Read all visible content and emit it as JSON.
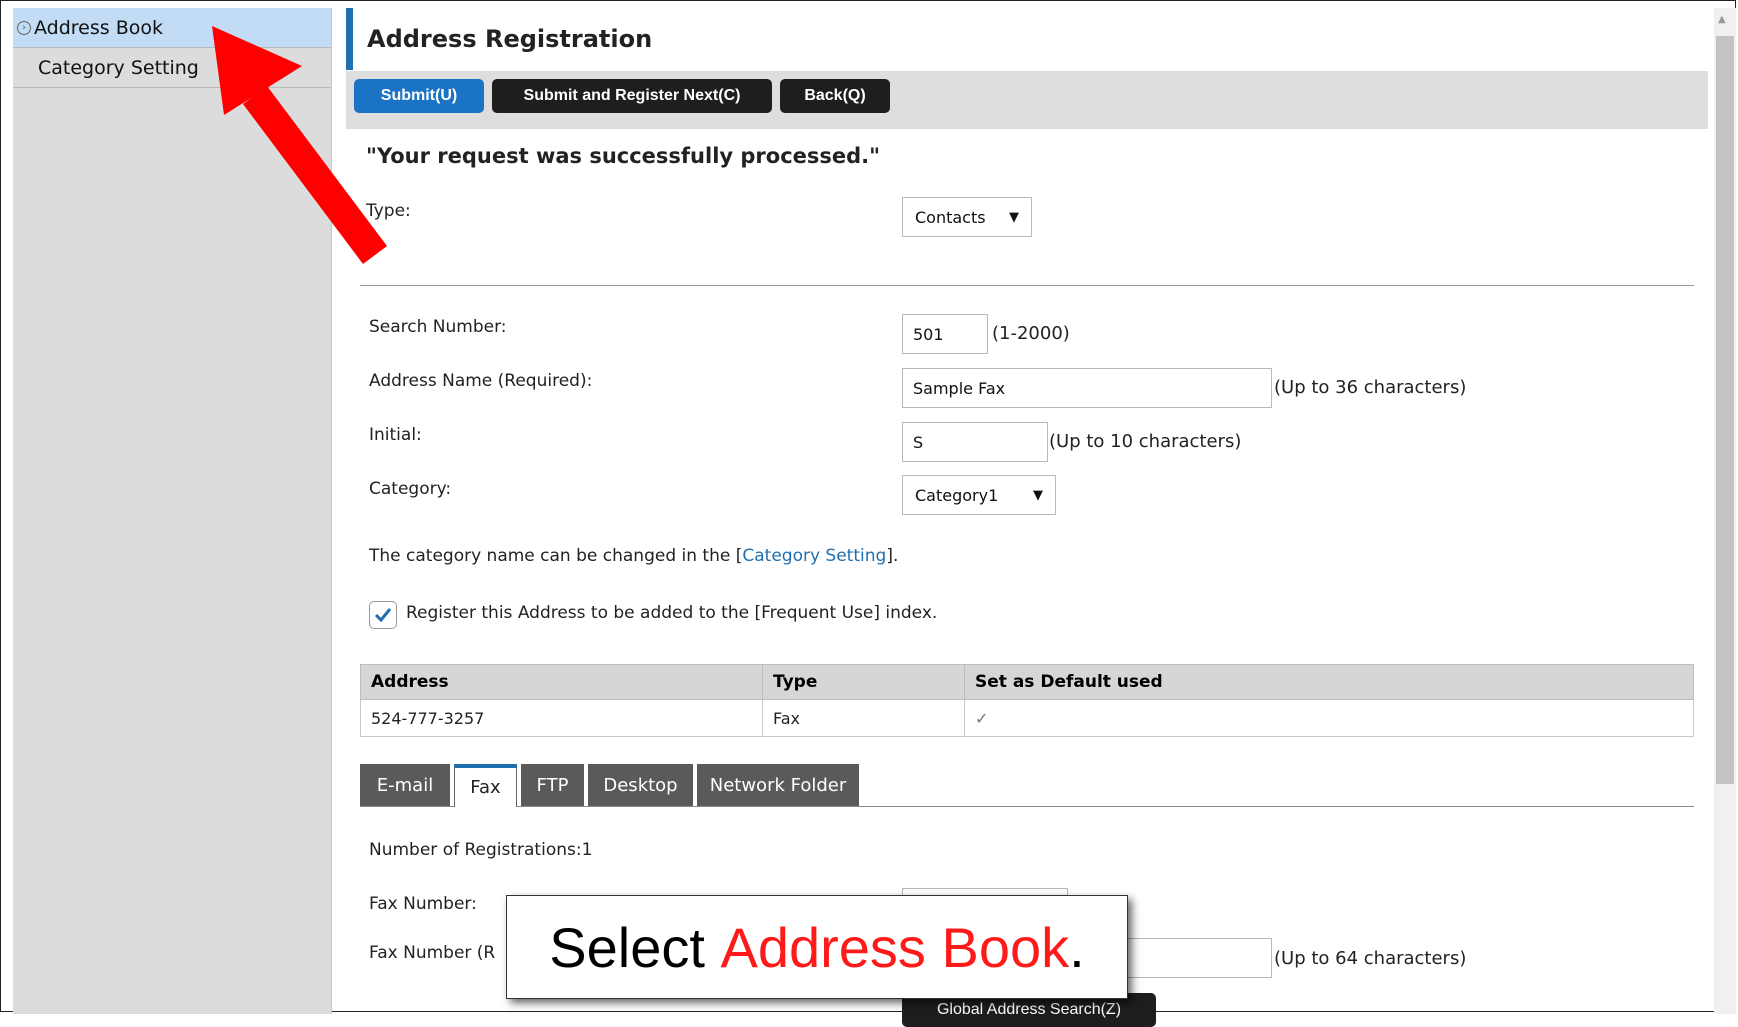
{
  "sidebar": {
    "items": [
      {
        "label": "Address Book",
        "active": true
      },
      {
        "label": "Category Setting",
        "active": false
      }
    ]
  },
  "header": {
    "title": "Address Registration"
  },
  "toolbar": {
    "submit": "Submit(U)",
    "submit_next": "Submit and Register Next(C)",
    "back": "Back(Q)"
  },
  "message": "\"Your request was successfully processed.\"",
  "form": {
    "type_label": "Type:",
    "type_value": "Contacts",
    "search_number_label": "Search Number:",
    "search_number_value": "501",
    "search_number_hint": "(1-2000)",
    "address_name_label": "Address Name (Required):",
    "address_name_value": "Sample Fax",
    "address_name_hint": "(Up to 36 characters)",
    "initial_label": "Initial:",
    "initial_value": "S",
    "initial_hint": "(Up to 10 characters)",
    "category_label": "Category:",
    "category_value": "Category1",
    "category_note_prefix": "The category name can be changed in the [",
    "category_note_link": "Category Setting",
    "category_note_suffix": "].",
    "frequent_use_label": "Register this Address to be added to the [Frequent Use] index.",
    "frequent_use_checked": true
  },
  "address_table": {
    "headers": [
      "Address",
      "Type",
      "Set as Default used"
    ],
    "rows": [
      [
        "524-777-3257",
        "Fax",
        "✓"
      ]
    ]
  },
  "tabs": [
    {
      "label": "E-mail",
      "active": false
    },
    {
      "label": "Fax",
      "active": true
    },
    {
      "label": "FTP",
      "active": false
    },
    {
      "label": "Desktop",
      "active": false
    },
    {
      "label": "Network Folder",
      "active": false
    }
  ],
  "fax_section": {
    "registrations_label": "Number of Registrations:1",
    "fax_number_label": "Fax Number:",
    "fax_number_r_label": "Fax Number (R",
    "fax_number_r_hint": "(Up to 64 characters)",
    "global_search_button": "Global Address Search(Z)"
  },
  "annotation": {
    "prefix": "Select ",
    "highlight": "Address Book",
    "suffix": ".",
    "arrow_color": "#ff0000"
  },
  "colors": {
    "accent": "#1f6fb2",
    "primary_button": "#1a73c4",
    "sidebar_active": "#c2dcf5"
  }
}
